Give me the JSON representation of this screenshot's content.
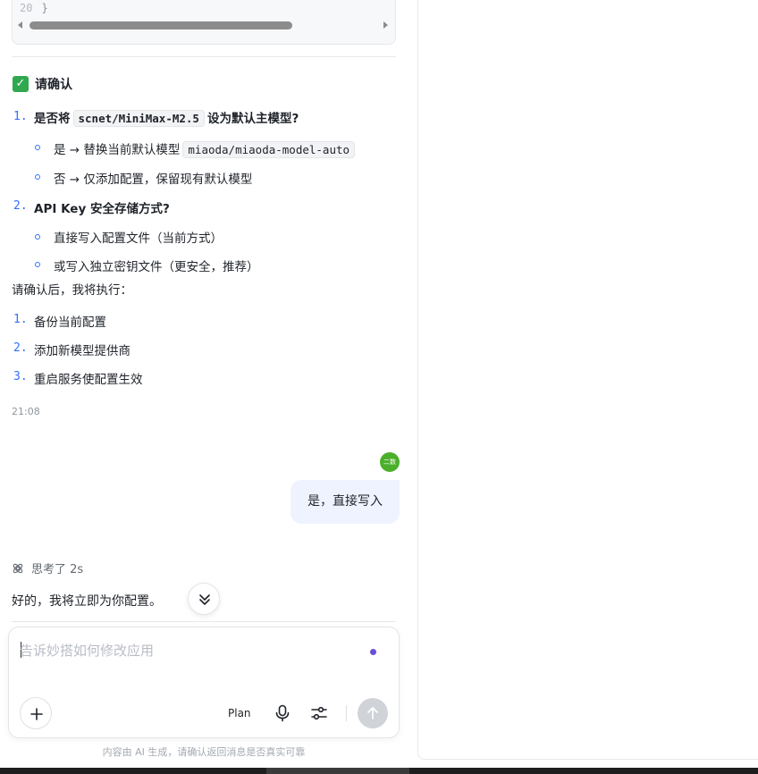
{
  "code_tail": {
    "line_number": "20",
    "text": "}"
  },
  "confirm": {
    "heading": "请确认",
    "items": [
      {
        "num": "1.",
        "pre": "是否将",
        "code": "scnet/MiniMax-M2.5",
        "post": "设为默认主模型?",
        "subs": [
          {
            "pre": "是 → 替换当前默认模型",
            "code": "miaoda/miaoda-model-auto"
          },
          {
            "pre": "否 → 仅添加配置，保留现有默认模型"
          }
        ]
      },
      {
        "num": "2.",
        "text": "API Key 安全存储方式?",
        "subs": [
          {
            "pre": "直接写入配置文件（当前方式）"
          },
          {
            "pre": "或写入独立密钥文件（更安全，推荐）"
          }
        ]
      }
    ],
    "after_text": "请确认后，我将执行：",
    "steps": [
      {
        "num": "1.",
        "text": "备份当前配置"
      },
      {
        "num": "2.",
        "text": "添加新模型提供商"
      },
      {
        "num": "3.",
        "text": "重启服务使配置生效"
      }
    ],
    "time": "21:08"
  },
  "user": {
    "avatar_text": "二数",
    "message": "是，直接写入"
  },
  "assistant": {
    "thinking": "思考了 2s",
    "reply": "好的，我将立即为你配置。"
  },
  "composer": {
    "placeholder": "告诉妙搭如何修改应用",
    "plan_label": "Plan"
  },
  "disclaimer": "内容由 AI 生成，请确认返回消息是否真实可靠",
  "colors": {
    "accent": "#3370ff",
    "bubble": "#eef3ff",
    "check": "#2fa84f",
    "avatar": "#4caf2a"
  },
  "icons": [
    "check-icon",
    "think-icon",
    "chevrons-down-icon",
    "plus-icon",
    "mic-icon",
    "sliders-icon",
    "arrow-up-icon"
  ]
}
